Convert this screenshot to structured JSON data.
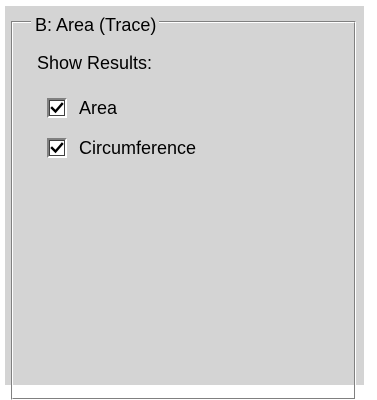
{
  "group": {
    "title": "B: Area (Trace)"
  },
  "section": {
    "label": "Show Results:"
  },
  "checkboxes": [
    {
      "label": "Area",
      "checked": true
    },
    {
      "label": "Circumference",
      "checked": true
    }
  ],
  "icons": {
    "check": "checkmark-icon"
  },
  "colors": {
    "panel_background": "#d4d4d4",
    "shadow": "#808080",
    "highlight": "#ffffff",
    "text": "#000000"
  }
}
